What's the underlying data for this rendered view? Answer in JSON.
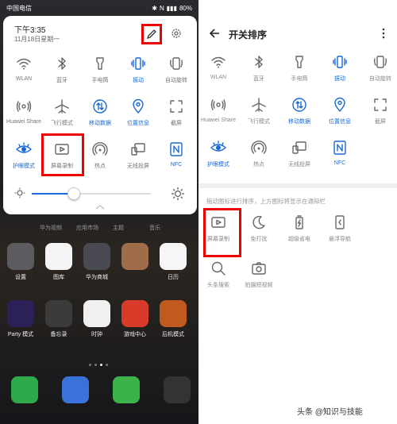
{
  "left_screen": {
    "status_bar": {
      "carrier": "中国电信",
      "battery": "80%"
    },
    "shade": {
      "time": "下午3:35",
      "date": "11月18日星期一",
      "tiles": [
        {
          "label": "WLAN",
          "icon": "wifi-icon",
          "on": false
        },
        {
          "label": "蓝牙",
          "icon": "bluetooth-icon",
          "on": false
        },
        {
          "label": "手电筒",
          "icon": "flashlight-icon",
          "on": false
        },
        {
          "label": "振动",
          "icon": "vibrate-icon",
          "on": true
        },
        {
          "label": "自动旋转",
          "icon": "rotate-icon",
          "on": false
        },
        {
          "label": "Huawei Share",
          "icon": "share-icon",
          "on": false
        },
        {
          "label": "飞行模式",
          "icon": "airplane-icon",
          "on": false
        },
        {
          "label": "移动数据",
          "icon": "mobile-data-icon",
          "on": true
        },
        {
          "label": "位置信息",
          "icon": "location-icon",
          "on": true
        },
        {
          "label": "截屏",
          "icon": "screenshot-icon",
          "on": false
        },
        {
          "label": "护眼模式",
          "icon": "eye-icon",
          "on": true
        },
        {
          "label": "屏幕录制",
          "icon": "screen-record-icon",
          "on": false
        },
        {
          "label": "热点",
          "icon": "hotspot-icon",
          "on": false
        },
        {
          "label": "无线投屏",
          "icon": "cast-icon",
          "on": false
        },
        {
          "label": "NFC",
          "icon": "nfc-icon",
          "on": true
        }
      ],
      "brightness_fraction": 0.35
    },
    "home": {
      "row1_ghost": [
        "华为视频",
        "应用市场",
        "主题",
        "音乐"
      ],
      "row2": [
        {
          "name": "设置",
          "color": "#5b5b60"
        },
        {
          "name": "图库",
          "color": "#f4f4f4"
        },
        {
          "name": "华为商城",
          "color": "#4a4a52"
        },
        {
          "name": "",
          "color": "#a06d4a"
        },
        {
          "name": "日历",
          "color": "#f6f6f6"
        }
      ],
      "row3": [
        {
          "name": "Party 模式",
          "color": "#2b2156"
        },
        {
          "name": "备忘录",
          "color": "#3b3b3b"
        },
        {
          "name": "时钟",
          "color": "#f0f0f0"
        },
        {
          "name": "游戏中心",
          "color": "#d83b2a"
        },
        {
          "name": "后机模式",
          "color": "#c05a1e"
        }
      ],
      "dock_colors": [
        "#2faa4a",
        "#3a72d9",
        "#3bb34a",
        "#333"
      ]
    }
  },
  "right_screen": {
    "title": "开关排序",
    "active_tiles": [
      {
        "label": "WLAN",
        "icon": "wifi-icon",
        "on": false
      },
      {
        "label": "蓝牙",
        "icon": "bluetooth-icon",
        "on": false
      },
      {
        "label": "手电筒",
        "icon": "flashlight-icon",
        "on": false
      },
      {
        "label": "振动",
        "icon": "vibrate-icon",
        "on": true
      },
      {
        "label": "自动旋转",
        "icon": "rotate-icon",
        "on": false
      },
      {
        "label": "Huawei Share",
        "icon": "share-icon",
        "on": false
      },
      {
        "label": "飞行模式",
        "icon": "airplane-icon",
        "on": false
      },
      {
        "label": "移动数据",
        "icon": "mobile-data-icon",
        "on": true
      },
      {
        "label": "位置信息",
        "icon": "location-icon",
        "on": true
      },
      {
        "label": "截屏",
        "icon": "screenshot-icon",
        "on": false
      },
      {
        "label": "护眼模式",
        "icon": "eye-icon",
        "on": true
      },
      {
        "label": "热点",
        "icon": "hotspot-icon",
        "on": false
      },
      {
        "label": "无线投屏",
        "icon": "cast-icon",
        "on": false
      },
      {
        "label": "NFC",
        "icon": "nfc-icon",
        "on": true
      }
    ],
    "hint": "拖动图标进行排序，上方图标将显示在通知栏",
    "inactive_tiles": [
      {
        "label": "屏幕录制",
        "icon": "screen-record-icon",
        "on": false
      },
      {
        "label": "免打扰",
        "icon": "moon-icon",
        "on": false
      },
      {
        "label": "超级省电",
        "icon": "battery-saver-icon",
        "on": false
      },
      {
        "label": "悬浮导航",
        "icon": "float-nav-icon",
        "on": false
      },
      {
        "label": "头条搜索",
        "icon": "search-icon",
        "on": false
      },
      {
        "label": "拍摄短视频",
        "icon": "camera-icon",
        "on": false
      }
    ]
  },
  "watermark": "头条 @知识与技能",
  "colors": {
    "accent": "#1769d6",
    "highlight": "#e00000"
  }
}
